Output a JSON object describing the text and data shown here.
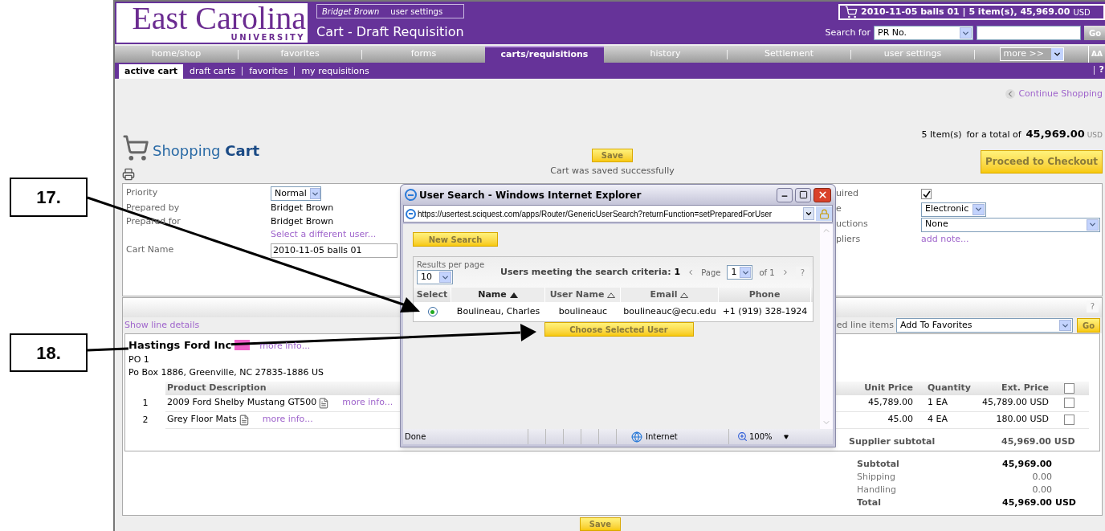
{
  "callouts": [
    {
      "label": "17."
    },
    {
      "label": "18."
    }
  ],
  "header": {
    "logo": {
      "name": "East Carolina",
      "sub": "UNIVERSITY"
    },
    "user": {
      "name": "Bridget Brown",
      "link": "user settings"
    },
    "page_title": "Cart - Draft Requisition",
    "cart_summary": "2010-11-05 balls 01 | 5 item(s), 45,969.00",
    "cart_currency": "USD",
    "search": {
      "label": "Search for",
      "select": "PR No.",
      "button": "Go"
    }
  },
  "nav": [
    {
      "label": "home/shop",
      "selected": false
    },
    {
      "label": "favorites",
      "selected": false
    },
    {
      "label": "forms",
      "selected": false
    },
    {
      "label": "carts/requisitions",
      "selected": true
    },
    {
      "label": "history",
      "selected": false
    },
    {
      "label": "Settlement",
      "selected": false
    },
    {
      "label": "user settings",
      "selected": false
    }
  ],
  "nav_more": "more >>",
  "nav_text_size": "AA",
  "subnav": [
    {
      "label": "active cart",
      "selected": true
    },
    {
      "label": "draft carts",
      "selected": false
    },
    {
      "label": "favorites",
      "selected": false
    },
    {
      "label": "my requisitions",
      "selected": false
    }
  ],
  "subnav_help": "?",
  "continue_shopping": "Continue Shopping",
  "heading": {
    "light": "Shopping",
    "bold": "Cart"
  },
  "totals_line": {
    "count": "5 Item(s)",
    "for": "for a total of",
    "amount": "45,969.00",
    "currency": "USD"
  },
  "checkout": "Proceed to Checkout",
  "save": "Save",
  "saved_message": "Cart was saved successfully",
  "form_left": [
    {
      "label": "Priority",
      "kind": "select",
      "value": "Normal"
    },
    {
      "label": "Prepared by",
      "kind": "text",
      "value": "Bridget Brown"
    },
    {
      "label": "Prepared for",
      "kind": "text",
      "value": "Bridget Brown",
      "link": "Select a different user..."
    },
    {
      "label": "Cart Name",
      "kind": "input",
      "value": "2010-11-05 balls 01"
    }
  ],
  "form_right": [
    {
      "label": "uired",
      "kind": "checkbox",
      "checked": true
    },
    {
      "label": "e",
      "kind": "select",
      "value": "Electronic"
    },
    {
      "label": "uctions",
      "kind": "wide_select",
      "value": "None"
    },
    {
      "label": "pliers",
      "kind": "link",
      "value": "add note..."
    }
  ],
  "band_help": "?",
  "line_details": "Show line details",
  "bulk": {
    "label": "ed line items",
    "select": "Add To Favorites",
    "button": "Go"
  },
  "supplier": {
    "name": "Hastings Ford Inc",
    "more": "more info...",
    "po": "PO 1",
    "address": "Po Box 1886, Greenville, NC 27835-1886 US",
    "columns": [
      "Product Description",
      "Unit Price",
      "Quantity",
      "Ext. Price"
    ],
    "header_checked": false,
    "items": [
      {
        "no": "1",
        "description": "2009 Ford Shelby Mustang GT500",
        "more": "more info...",
        "unit_price": "45,789.00",
        "quantity": "1 EA",
        "ext_price": "45,789.00 USD",
        "checked": false
      },
      {
        "no": "2",
        "description": "Grey Floor Mats",
        "more": "more info...",
        "unit_price": "45.00",
        "quantity": "4 EA",
        "ext_price": "180.00 USD",
        "checked": false
      }
    ],
    "subtotal_label": "Supplier subtotal",
    "subtotal": "45,969.00 USD"
  },
  "summary": [
    {
      "label": "Subtotal",
      "value": "45,969.00",
      "kind": "strong"
    },
    {
      "label": "Shipping",
      "value": "0.00",
      "kind": "plain"
    },
    {
      "label": "Handling",
      "value": "0.00",
      "kind": "plain"
    },
    {
      "label": "Total",
      "value": "45,969.00",
      "currency": "USD",
      "kind": "strong"
    }
  ],
  "bottom_save": "Save",
  "popup": {
    "title": "User Search - Windows Internet Explorer",
    "url": "https://usertest.sciquest.com/apps/Router/GenericUserSearch?returnFunction=setPreparedForUser",
    "new_search": "New Search",
    "results_label": "Results per page",
    "results_value": "10",
    "criteria": "Users meeting the search criteria:",
    "count": "1",
    "page_label": "Page",
    "page_value": "1",
    "page_of": "of 1",
    "help": "?",
    "columns": [
      {
        "label": "Select",
        "sortable": false,
        "sorted": false
      },
      {
        "label": "Name",
        "sortable": true,
        "sorted": true
      },
      {
        "label": "User Name",
        "sortable": true,
        "sorted": false
      },
      {
        "label": "Email",
        "sortable": true,
        "sorted": false
      },
      {
        "label": "Phone",
        "sortable": false,
        "sorted": false
      }
    ],
    "rows": [
      {
        "selected": true,
        "name": "Boulineau, Charles",
        "user_name": "boulineauc",
        "email": "boulineauc@ecu.edu",
        "phone": "+1 (919) 328-1924"
      }
    ],
    "choose": "Choose Selected User",
    "status": {
      "left": "Done",
      "zone": "Internet",
      "zoom": "100%"
    }
  }
}
